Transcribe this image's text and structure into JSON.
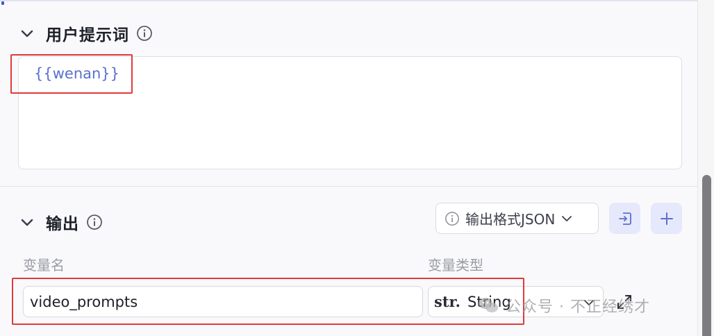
{
  "prompt_section": {
    "title": "用户提示词",
    "content": "{{wenan}}"
  },
  "output_section": {
    "title": "输出",
    "format_select": {
      "label": "输出格式JSON"
    },
    "columns": {
      "var_name": "变量名",
      "var_type": "变量类型"
    },
    "variable": {
      "name": "video_prompts",
      "type_prefix": "str.",
      "type": "String"
    }
  },
  "watermark": {
    "text": "公众号 · 不正经绣才"
  },
  "colors": {
    "accent": "#5b6fce",
    "highlight_box": "#e0393a",
    "icon_button_bg": "#e6e8fb"
  },
  "icons": {
    "collapse": "chevron-down-icon",
    "info": "info-icon",
    "import": "import-icon",
    "add": "plus-icon",
    "expand": "expand-icon"
  }
}
